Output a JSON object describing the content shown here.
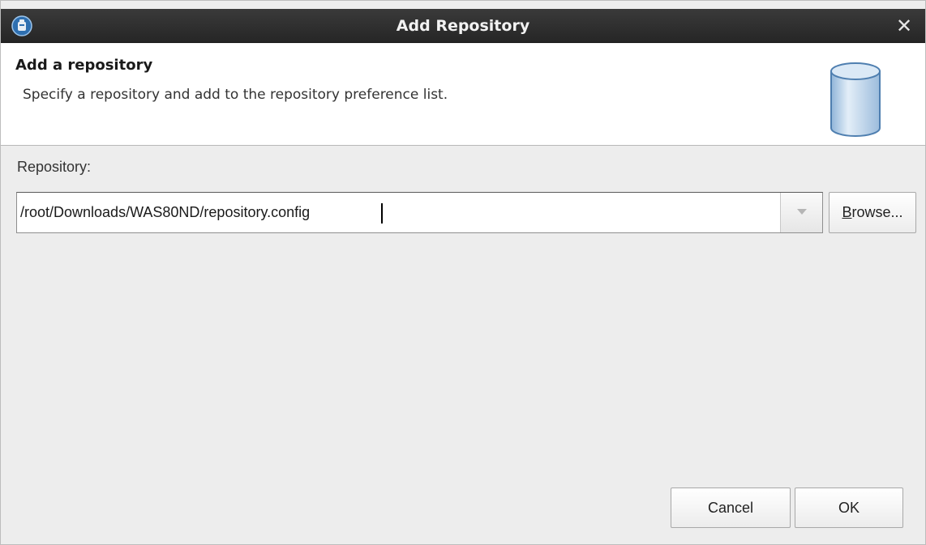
{
  "window": {
    "title": "Add Repository",
    "close_glyph": "✕",
    "app_icon": "installation-manager-icon"
  },
  "banner": {
    "title": "Add a repository",
    "description": "Specify a repository and add to the repository preference list.",
    "icon": "database-cylinder-icon"
  },
  "repository": {
    "label": "Repository:",
    "value": "/root/Downloads/WAS80ND/repository.config",
    "dropdown_icon": "chevron-down-icon"
  },
  "buttons": {
    "browse_mnemonic": "B",
    "browse_rest": "rowse...",
    "cancel": "Cancel",
    "ok": "OK"
  },
  "colors": {
    "titlebar": "#2d2d2d",
    "dialog_bg": "#ededed",
    "banner_bg": "#ffffff",
    "database_icon": "#b9d3ea"
  }
}
